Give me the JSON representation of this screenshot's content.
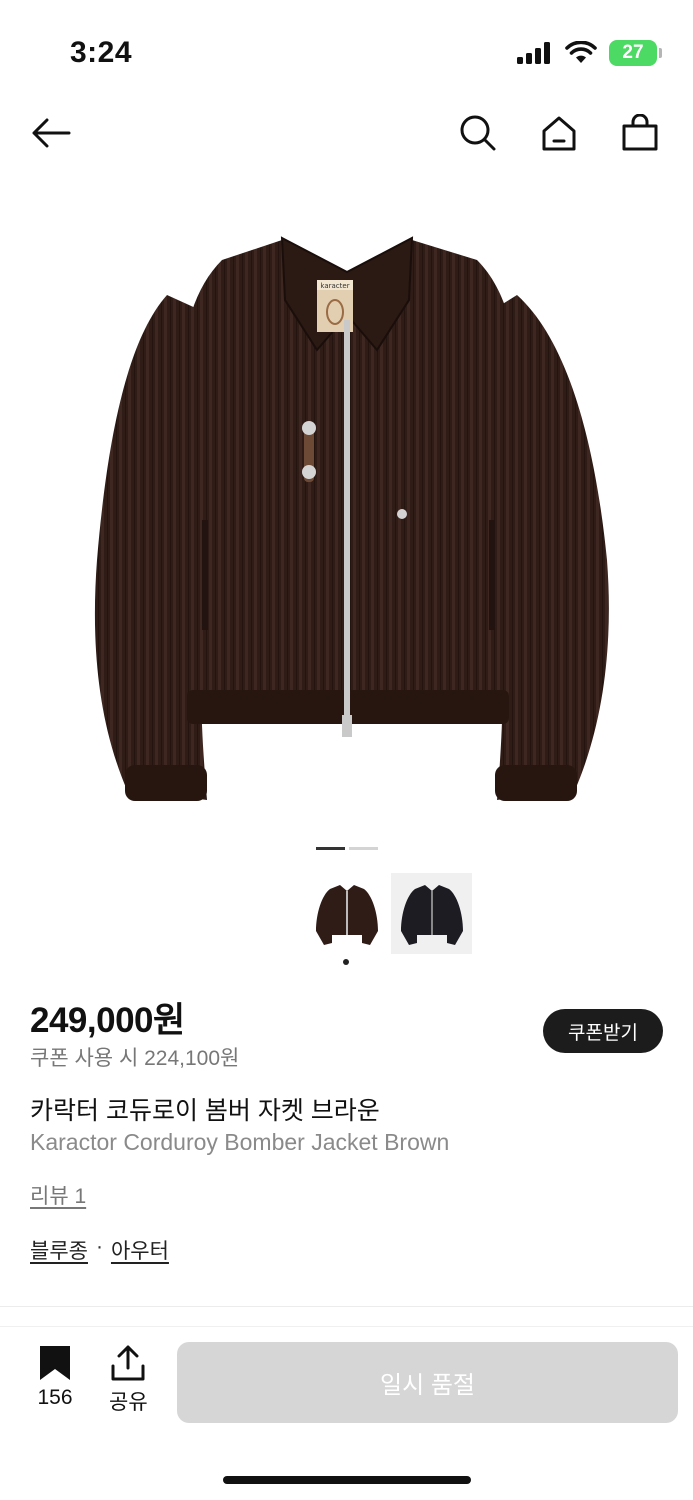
{
  "status_bar": {
    "time": "3:24",
    "battery": "27",
    "icons": [
      "cellular-signal-icon",
      "wifi-icon",
      "battery-icon"
    ]
  },
  "nav": {
    "icons": [
      "back-arrow-icon",
      "search-icon",
      "home-icon",
      "shopping-bag-icon"
    ]
  },
  "gallery": {
    "image_count": 2,
    "active_index": 1,
    "thumbnails": [
      {
        "color": "#2f1c17",
        "selected": true
      },
      {
        "color": "#1c1c22",
        "selected": false
      }
    ],
    "label_tag": "karacter"
  },
  "product": {
    "price": "249,000원",
    "coupon_price": "쿠폰 사용 시 224,100원",
    "coupon_button": "쿠폰받기",
    "name_ko": "카락터 코듀로이 봄버 자켓 브라운",
    "name_en": "Karactor Corduroy Bomber Jacket Brown",
    "review_link": "리뷰 1",
    "categories": [
      "블루종",
      "아우터"
    ],
    "category_separator": "·"
  },
  "bottom_bar": {
    "bookmark_count": "156",
    "share_label": "공유",
    "soldout_label": "일시 품절"
  },
  "colors": {
    "jacket_brown": "#2f1c17",
    "coupon_button_bg": "#1c1c1c",
    "soldout_bg": "#d6d6d6",
    "battery_green": "#4cd964"
  }
}
